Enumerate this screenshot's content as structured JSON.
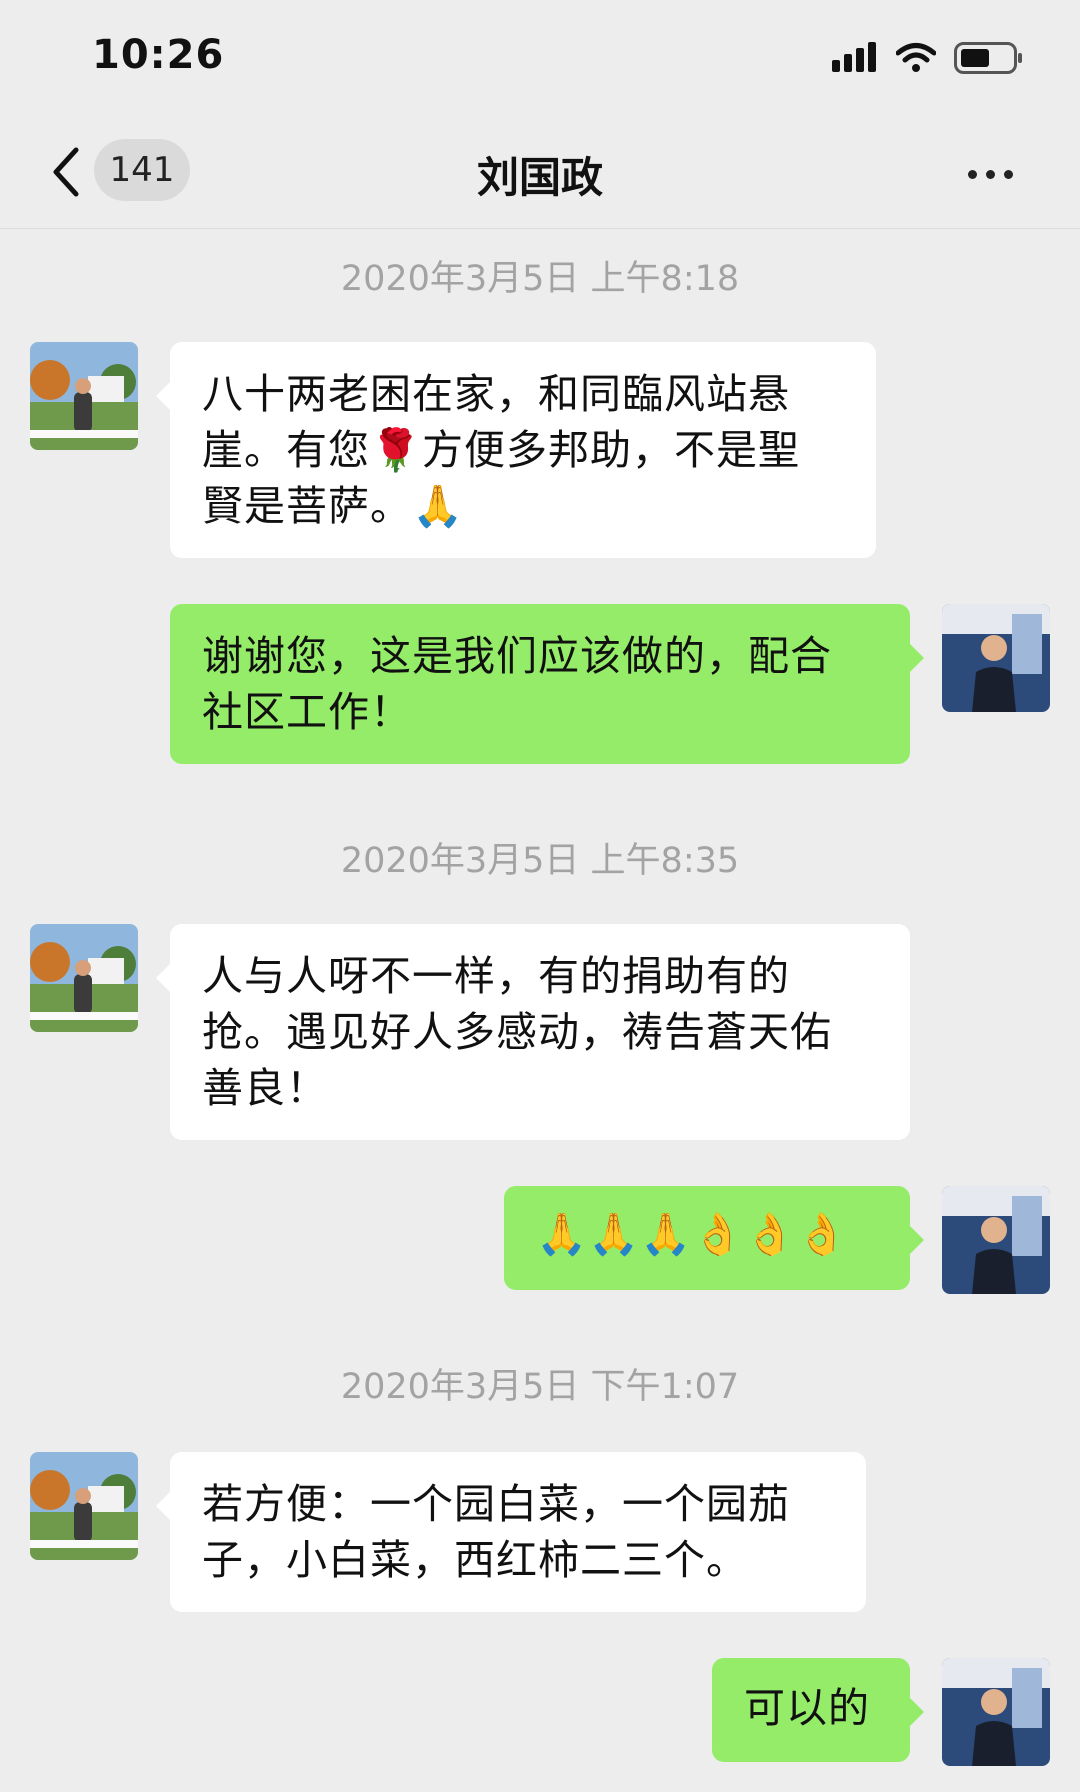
{
  "status_bar": {
    "time": "10:26"
  },
  "nav": {
    "unread_count": "141",
    "title": "刘国政"
  },
  "colors": {
    "background": "#ededed",
    "incoming_bubble": "#ffffff",
    "outgoing_bubble": "#95ec69",
    "timestamp_text": "#a3a3a3"
  },
  "timestamps": [
    "2020年3月5日 上午8:18",
    "2020年3月5日 上午8:35",
    "2020年3月5日 下午1:07"
  ],
  "messages": [
    {
      "direction": "incoming",
      "text": "八十两老困在家，和同臨风站悬\n崖。有您🌹方便多邦助，不是聖\n賢是菩萨。🙏"
    },
    {
      "direction": "outgoing",
      "text": "谢谢您，这是我们应该做的，配合\n社区工作！"
    },
    {
      "direction": "incoming",
      "text": "人与人呀不一样，有的捐助有的\n抢。遇见好人多感动，祷告蒼天佑\n善良！"
    },
    {
      "direction": "outgoing",
      "text": "🙏🙏🙏👌👌👌"
    },
    {
      "direction": "incoming",
      "text": "若方便：一个园白菜，一个园茄\n子，小白菜，西红柿二三个。"
    },
    {
      "direction": "outgoing",
      "text": "可以的"
    }
  ],
  "icons": {
    "back": "chevron-left-icon",
    "more": "more-dots-icon",
    "signal": "signal-icon",
    "wifi": "wifi-icon",
    "battery": "battery-icon",
    "contact_avatar": "contact-avatar",
    "my_avatar": "my-avatar"
  }
}
